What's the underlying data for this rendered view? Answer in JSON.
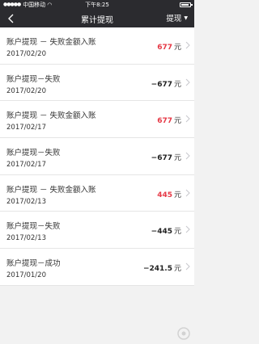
{
  "status_bar": {
    "carrier": "中国移动",
    "time": "下午8:25"
  },
  "nav": {
    "title": "累计提现",
    "action_label": "提现",
    "back_icon": "chevron-left-icon"
  },
  "records": [
    {
      "name": "账户提现 － 失败金额入账",
      "date": "2017/02/20",
      "amount": "677",
      "unit": "元",
      "color": "#e63946"
    },
    {
      "name": "账户提现－失败",
      "date": "2017/02/20",
      "amount": "−677",
      "unit": "元",
      "color": "#222222"
    },
    {
      "name": "账户提现 － 失败金额入账",
      "date": "2017/02/17",
      "amount": "677",
      "unit": "元",
      "color": "#e63946"
    },
    {
      "name": "账户提现－失败",
      "date": "2017/02/17",
      "amount": "−677",
      "unit": "元",
      "color": "#222222"
    },
    {
      "name": "账户提现 － 失败金额入账",
      "date": "2017/02/13",
      "amount": "445",
      "unit": "元",
      "color": "#e63946"
    },
    {
      "name": "账户提现－失败",
      "date": "2017/02/13",
      "amount": "−445",
      "unit": "元",
      "color": "#222222"
    },
    {
      "name": "账户提现－成功",
      "date": "2017/01/20",
      "amount": "−241.5",
      "unit": "元",
      "color": "#222222"
    }
  ]
}
